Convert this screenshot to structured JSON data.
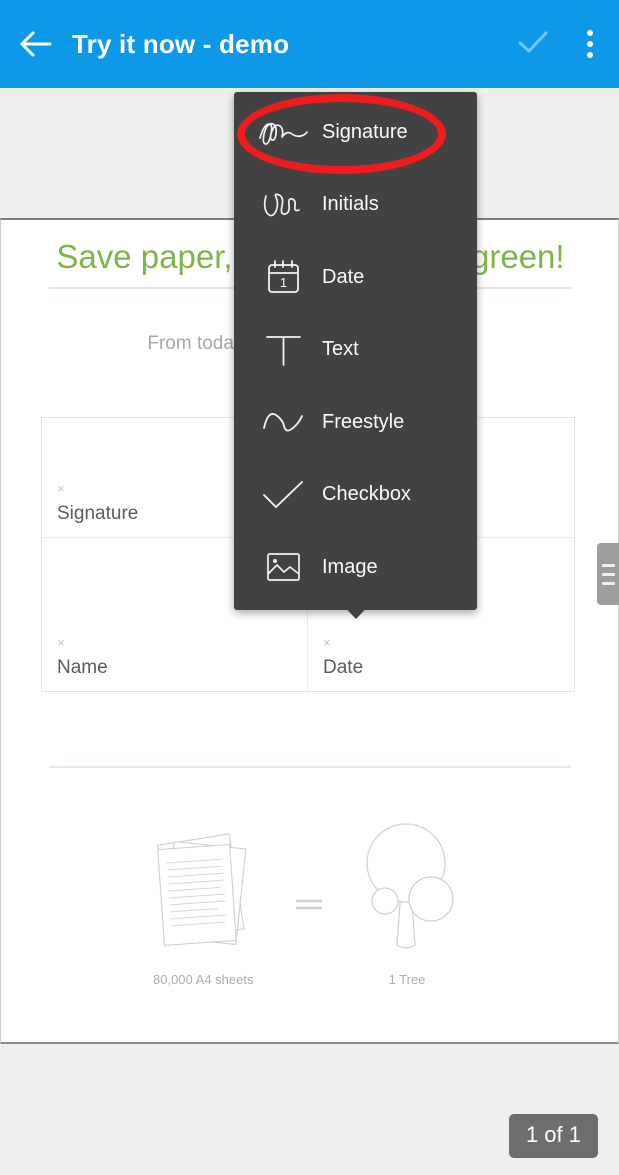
{
  "appbar": {
    "back_icon": "arrow-back-icon",
    "title": "Try it now - demo",
    "confirm_icon": "check-icon",
    "overflow_icon": "more-vertical-icon",
    "background_color": "#0d99e8"
  },
  "document": {
    "heading": "Save paper, Save trees, Go green!",
    "heading_color": "#7fb548",
    "subtitle": "From today onwards, no more printing.",
    "form": {
      "rows": [
        {
          "cells": [
            {
              "x_mark": "×",
              "label": "Signature"
            }
          ]
        },
        {
          "cells": [
            {
              "x_mark": "×",
              "label": "Name"
            },
            {
              "x_mark": "×",
              "label": "Date"
            }
          ]
        }
      ]
    },
    "eco": {
      "sheets_caption": "80,000 A4 sheets",
      "equals_symbol": "=",
      "tree_caption": "1 Tree"
    }
  },
  "menu": {
    "items": [
      {
        "icon": "signature-icon",
        "label": "Signature",
        "highlighted": true
      },
      {
        "icon": "initials-icon",
        "label": "Initials",
        "highlighted": false
      },
      {
        "icon": "calendar-icon",
        "label": "Date",
        "highlighted": false
      },
      {
        "icon": "text-icon",
        "label": "Text",
        "highlighted": false
      },
      {
        "icon": "freestyle-icon",
        "label": "Freestyle",
        "highlighted": false
      },
      {
        "icon": "checkbox-icon",
        "label": "Checkbox",
        "highlighted": false
      },
      {
        "icon": "image-icon",
        "label": "Image",
        "highlighted": false
      }
    ],
    "background_color": "#424242"
  },
  "annotation": {
    "shape": "ellipse",
    "color": "#ee1c1c",
    "targets": "Signature"
  },
  "page_badge": {
    "text": "1 of 1"
  },
  "scroll_handle": {
    "icon": "scroll-handle-icon"
  }
}
